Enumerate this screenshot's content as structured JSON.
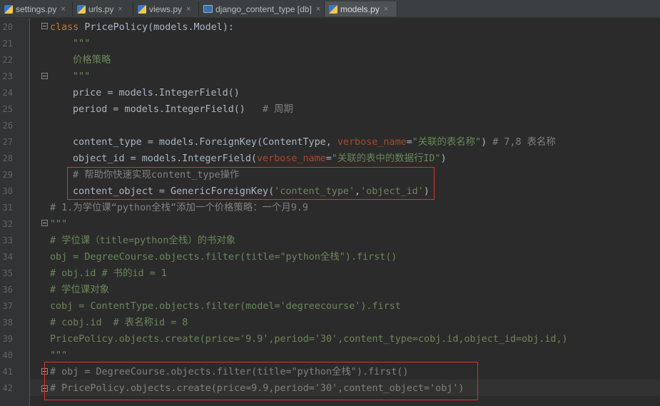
{
  "tabs": [
    {
      "label": "settings.py",
      "type": "python",
      "active": false
    },
    {
      "label": "urls.py",
      "type": "python",
      "active": false
    },
    {
      "label": "views.py",
      "type": "python",
      "active": false
    },
    {
      "label": "django_content_type [db]",
      "type": "db",
      "active": false
    },
    {
      "label": "models.py",
      "type": "python",
      "active": true
    }
  ],
  "close_glyph": "×",
  "line_numbers": [
    "20",
    "21",
    "22",
    "23",
    "24",
    "25",
    "26",
    "27",
    "28",
    "29",
    "30",
    "31",
    "32",
    "33",
    "34",
    "35",
    "36",
    "37",
    "38",
    "39",
    "40",
    "41",
    "42"
  ],
  "code": {
    "l20": {
      "kw": "class",
      "name": " PricePolicy(models.Model):"
    },
    "l21": {
      "text": "\"\"\""
    },
    "l22": {
      "text": "价格策略"
    },
    "l23": {
      "text": "\"\"\""
    },
    "l24": {
      "text": "price = models.IntegerField()"
    },
    "l25": {
      "code": "period = models.IntegerField()",
      "comment": "# 周期"
    },
    "l27": {
      "a": "content_type = models.ForeignKey(ContentType, ",
      "param": "verbose_name",
      "eq": "=",
      "str": "\"关联的表名称\"",
      "b": ")",
      "comment": " # 7,8 表名称"
    },
    "l28": {
      "a": "object_id = models.IntegerField(",
      "param": "verbose_name",
      "eq": "=",
      "str": "\"关联的表中的数据行ID\"",
      "b": ")"
    },
    "l29": {
      "comment": "# 帮助你快速实现content_type操作"
    },
    "l30": {
      "a": "content_object = GenericForeignKey(",
      "s1": "'content_type'",
      "sep": ",",
      "s2": "'object_id'",
      "b": ")"
    },
    "l31": {
      "comment": "# 1.为学位课“python全栈”添加一个价格策略：一个月9.9"
    },
    "l32": {
      "text": "\"\"\""
    },
    "l33": {
      "comment": "# 学位课（title=python全栈）的书对象"
    },
    "l34": {
      "a": "obj = DegreeCourse.objects.filter(title=",
      "str": "\"python全栈\"",
      "b": ").first()"
    },
    "l35": {
      "comment": "# obj.id # 书的id = 1"
    },
    "l36": {
      "comment": "# 学位课对象"
    },
    "l37": {
      "a": "cobj = ContentType.objects.filter(model=",
      "str": "'degreecourse'",
      "b": ").first"
    },
    "l38": {
      "comment": "# cobj.id  # 表名称id = 8"
    },
    "l39": {
      "a": "PricePolicy.objects.create(price=",
      "s1": "'9.9'",
      "m": ",period=",
      "s2": "'30'",
      "b": ",content_type=cobj.id,object_id=obj.id,)"
    },
    "l40": {
      "text": "\"\"\""
    },
    "l41": {
      "comment": "# obj = DegreeCourse.objects.filter(title=\"python全栈\").first()"
    },
    "l42": {
      "comment": "# PricePolicy.objects.create(price=9.9,period='30',content_object='obj')"
    }
  },
  "colors": {
    "highlight_box": "#e0322b",
    "keyword": "#cc7832",
    "string": "#6a8759",
    "comment": "#808080",
    "param": "#aa4926"
  }
}
